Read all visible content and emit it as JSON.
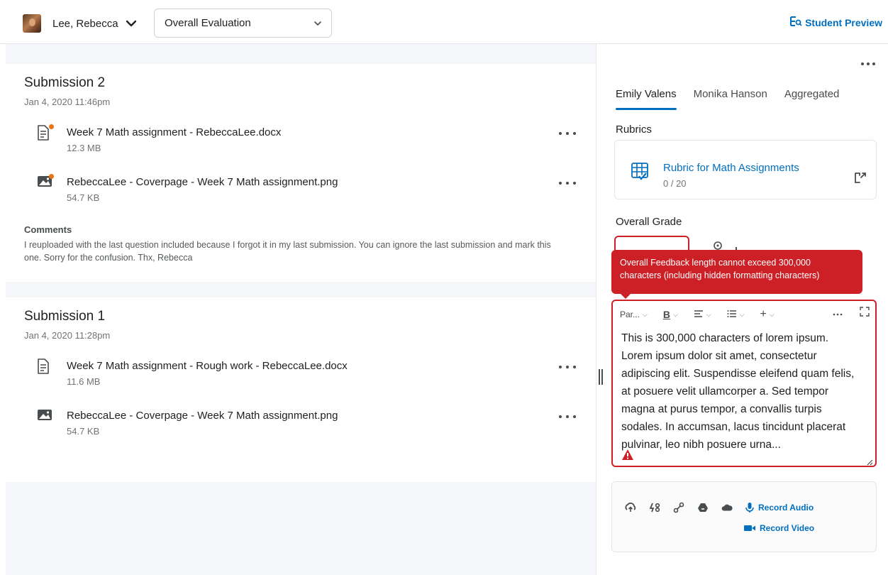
{
  "header": {
    "user_name": "Lee, Rebecca",
    "evaluation_select": "Overall Evaluation",
    "student_preview": "Student Preview"
  },
  "submissions": [
    {
      "title": "Submission 2",
      "date": "Jan 4, 2020 11:46pm",
      "files": [
        {
          "name": "Week 7 Math assignment - RebeccaLee.docx",
          "size": "12.3 MB",
          "icon": "document-icon",
          "new": true
        },
        {
          "name": "RebeccaLee - Coverpage - Week 7 Math assignment.png",
          "size": "54.7 KB",
          "icon": "image-icon",
          "new": true
        }
      ],
      "comments_label": "Comments",
      "comments_text": "I reuploaded with the last question included because I forgot it in my last submission. You can ignore the last submission and mark this one. Sorry for the confusion. Thx, Rebecca"
    },
    {
      "title": "Submission 1",
      "date": "Jan 4, 2020 11:28pm",
      "files": [
        {
          "name": "Week 7 Math assignment - Rough work - RebeccaLee.docx",
          "size": "11.6 MB",
          "icon": "document-icon",
          "new": false
        },
        {
          "name": "RebeccaLee - Coverpage - Week 7 Math assignment.png",
          "size": "54.7 KB",
          "icon": "image-icon",
          "new": false
        }
      ]
    }
  ],
  "panel": {
    "tabs": [
      "Emily Valens",
      "Monika Hanson",
      "Aggregated"
    ],
    "active_tab": "Emily Valens",
    "rubrics_heading": "Rubrics",
    "rubric_name": "Rubric for Math Assignments",
    "rubric_score": "0 / 20",
    "overall_grade_heading": "Overall Grade",
    "error_tooltip": "Overall Feedback length cannot exceed 300,000 characters (including hidden formatting characters)",
    "toolbar": {
      "paragraph": "Par...",
      "bold": "B",
      "insert": "+"
    },
    "feedback_text": "This is 300,000 characters of lorem ipsum. Lorem ipsum dolor sit amet, consectetur adipiscing elit. Suspendisse eleifend quam felis, at posuere velit ullamcorper a. Sed tempor magna at purus tempor, a convallis turpis sodales. In accumsan, lacus tincidunt placerat pulvinar, leo nibh posuere urna...",
    "record_audio": "Record Audio",
    "record_video": "Record Video"
  },
  "colors": {
    "accent": "#006fbf",
    "error": "#cd2026",
    "new_dot": "#e87511"
  }
}
